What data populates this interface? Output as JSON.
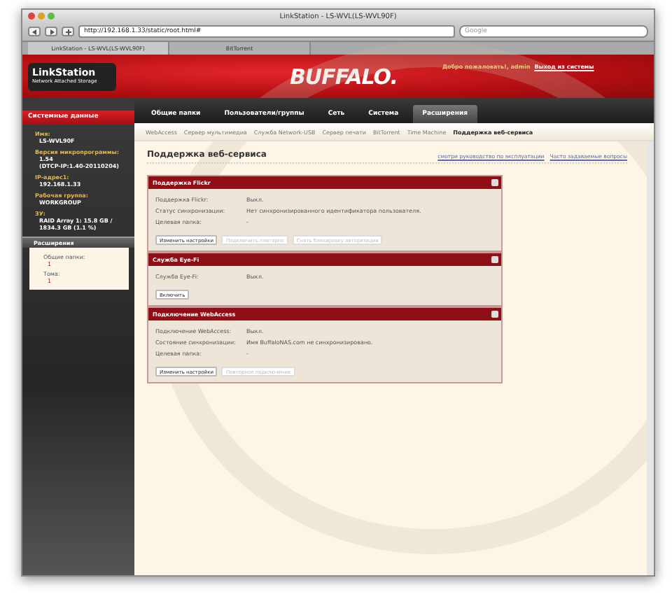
{
  "window": {
    "title": "LinkStation - LS-WVL(LS-WVL90F)"
  },
  "browser": {
    "url": "http://192.168.1.33/static/root.html#",
    "search_placeholder": "Google",
    "tabs": [
      {
        "label": "LinkStation - LS-WVL(LS-WVL90F)",
        "selected": true
      },
      {
        "label": "BitTorrent",
        "selected": false
      }
    ]
  },
  "header": {
    "logo_title": "LinkStation",
    "logo_subtitle": "Network Attached Storage",
    "brand": "BUFFALO.",
    "welcome": "Добро пожаловать!, admin",
    "logout": "Выход из системы"
  },
  "nav": [
    {
      "label": "Общие папки",
      "selected": false
    },
    {
      "label": "Пользователи/группы",
      "selected": false
    },
    {
      "label": "Сеть",
      "selected": false
    },
    {
      "label": "Система",
      "selected": false
    },
    {
      "label": "Расширения",
      "selected": true
    }
  ],
  "subnav": [
    {
      "label": "WebAccess",
      "selected": false
    },
    {
      "label": "Сервер мультимедиа",
      "selected": false
    },
    {
      "label": "Служба Network-USB",
      "selected": false
    },
    {
      "label": "Сервер печати",
      "selected": false
    },
    {
      "label": "BitTorrent",
      "selected": false
    },
    {
      "label": "Time Machine",
      "selected": false
    },
    {
      "label": "Поддержка веб-сервиса",
      "selected": true
    }
  ],
  "sidebar": {
    "title": "Системные данные",
    "items": [
      {
        "label": "Имя:",
        "value": "LS-WVL90F"
      },
      {
        "label": "Версия микропрограммы:",
        "value": "1.54\n(DTCP-IP:1.40-20110204)"
      },
      {
        "label": "IP-адрес1:",
        "value": "192.168.1.33"
      },
      {
        "label": "Рабочая группа:",
        "value": "WORKGROUP"
      },
      {
        "label": "ЗУ:",
        "value": "RAID Array 1: 15.8 GB /\n1834.3 GB (1.1 %)"
      }
    ],
    "ext_title": "Расширения",
    "ext_items": [
      {
        "label": "Общие папки:",
        "value": "1"
      },
      {
        "label": "Тома:",
        "value": "1"
      }
    ]
  },
  "page": {
    "title": "Поддержка веб-сервиса",
    "links": [
      "смотри руководство по эксплуатации",
      "Часто задаваемые вопросы"
    ]
  },
  "panels": [
    {
      "title": "Поддержка Flickr",
      "rows": [
        {
          "label": "Поддержка Flickr:",
          "value": "Выкл."
        },
        {
          "label": "Статус синхронизации:",
          "value": "Нет синхронизированного идентификатора пользователя."
        },
        {
          "label": "Целевая папка:",
          "value": "-"
        }
      ],
      "buttons": [
        {
          "label": "Изменить настройки",
          "disabled": false
        },
        {
          "label": "Подключить повторно",
          "disabled": true
        },
        {
          "label": "Снять блокировку авторизации",
          "disabled": true
        }
      ]
    },
    {
      "title": "Служба Eye-Fi",
      "rows": [
        {
          "label": "Служба Eye-Fi:",
          "value": "Выкл."
        }
      ],
      "buttons": [
        {
          "label": "Включить",
          "disabled": false
        }
      ]
    },
    {
      "title": "Подключение WebAccess",
      "rows": [
        {
          "label": "Подключение WebAccess:",
          "value": "Выкл."
        },
        {
          "label": "Состояние синхронизации:",
          "value": "Имя BuffaloNAS.com не синхронизировано."
        },
        {
          "label": "Целевая папка:",
          "value": "-"
        }
      ],
      "buttons": [
        {
          "label": "Изменить настройки",
          "disabled": false
        },
        {
          "label": "Повторное подключение",
          "disabled": true
        }
      ]
    }
  ]
}
